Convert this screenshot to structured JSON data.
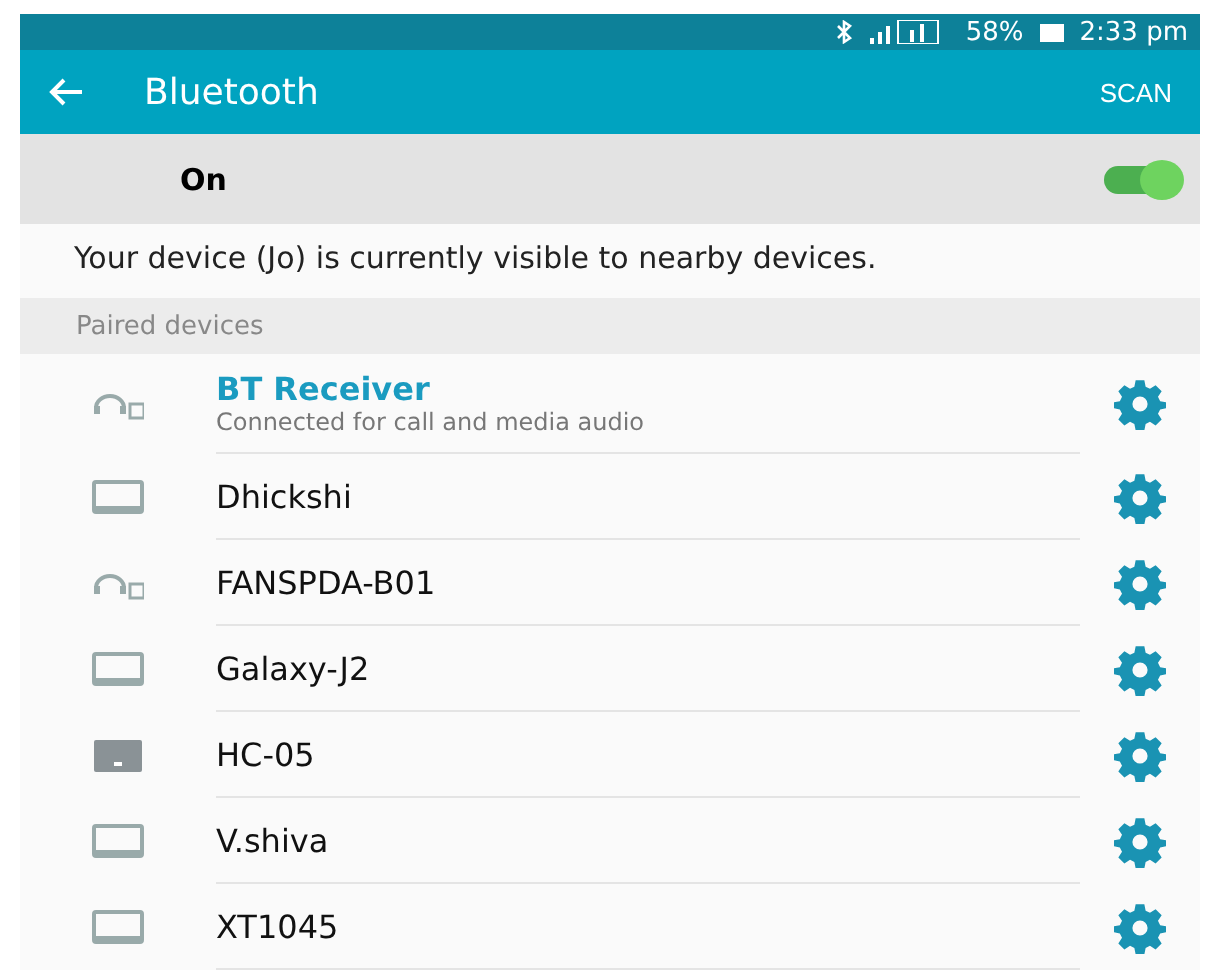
{
  "status_bar": {
    "battery": "58%",
    "time": "2:33 pm"
  },
  "app_bar": {
    "title": "Bluetooth",
    "action": "SCAN"
  },
  "bluetooth_switch": {
    "label": "On",
    "on": true
  },
  "visibility_text": "Your device (Jo) is currently visible to nearby devices.",
  "paired_header": "Paired devices",
  "devices": [
    {
      "name": "BT Receiver",
      "kind": "headset",
      "connected": true,
      "status": "Connected for call and media audio"
    },
    {
      "name": "Dhickshi",
      "kind": "laptop",
      "connected": false
    },
    {
      "name": "FANSPDA-B01",
      "kind": "headset",
      "connected": false
    },
    {
      "name": "Galaxy-J2",
      "kind": "laptop",
      "connected": false
    },
    {
      "name": "HC-05",
      "kind": "module",
      "connected": false
    },
    {
      "name": "V.shiva",
      "kind": "laptop",
      "connected": false
    },
    {
      "name": "XT1045",
      "kind": "laptop",
      "connected": false
    }
  ]
}
